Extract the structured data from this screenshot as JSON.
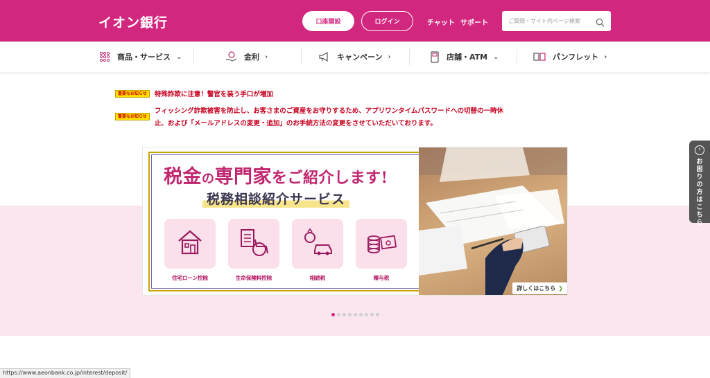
{
  "header": {
    "logo": "イオン銀行",
    "open_account": "口座開設",
    "login": "ログイン",
    "chat": "チャット",
    "support": "サポート",
    "search_placeholder": "ご質問・サイト内ページ検索"
  },
  "nav": [
    {
      "label": "商品・サービス",
      "icon": "grid-dots-icon",
      "arrow": "chevron-down"
    },
    {
      "label": "金利",
      "icon": "hand-coin-icon",
      "arrow": "chevron-right"
    },
    {
      "label": "キャンペーン",
      "icon": "megaphone-icon",
      "arrow": "chevron-right"
    },
    {
      "label": "店舗・ATM",
      "icon": "atm-icon",
      "arrow": "chevron-down"
    },
    {
      "label": "パンフレット",
      "icon": "pamphlet-icon",
      "arrow": "chevron-right"
    }
  ],
  "notices": [
    {
      "badge": "重要なお知らせ",
      "text": "特殊詐欺に注意！警官を装う手口が増加"
    },
    {
      "badge": "重要なお知らせ",
      "text_line1": "フィッシング詐欺被害を防止し、お客さまのご資産をお守りするため、アプリワンタイムパスワードへの切替の一時休",
      "text_line2": "止、および「メールアドレスの変更・追加」のお手続方法の変更をさせていただいております。"
    }
  ],
  "banner": {
    "title_a": "税金",
    "title_b": "の",
    "title_c": "専門家",
    "title_d": "をご紹介します!",
    "subtitle": "税務相談紹介サービス",
    "cards": [
      {
        "label": "住宅ローン控除",
        "icon": "house-icon"
      },
      {
        "label": "生命保険料控除",
        "icon": "wheelchair-clipboard-icon"
      },
      {
        "label": "相続税",
        "icon": "ring-car-icon"
      },
      {
        "label": "贈与税",
        "icon": "money-coins-icon"
      }
    ],
    "detail_button": "詳しくはこちら",
    "detail_arrow": "❯"
  },
  "carousel": {
    "count": 9,
    "active": 0
  },
  "side_tab": {
    "icon_glyph": "›",
    "label": "お困りの方はこちら"
  },
  "status_url": "https://www.aeonbank.co.jp/interest/deposit/",
  "colors": {
    "brand": "#d2277f",
    "pink_band": "#fbe6f0",
    "notice_red": "#c7001f",
    "badge_yellow": "#ffe100"
  }
}
